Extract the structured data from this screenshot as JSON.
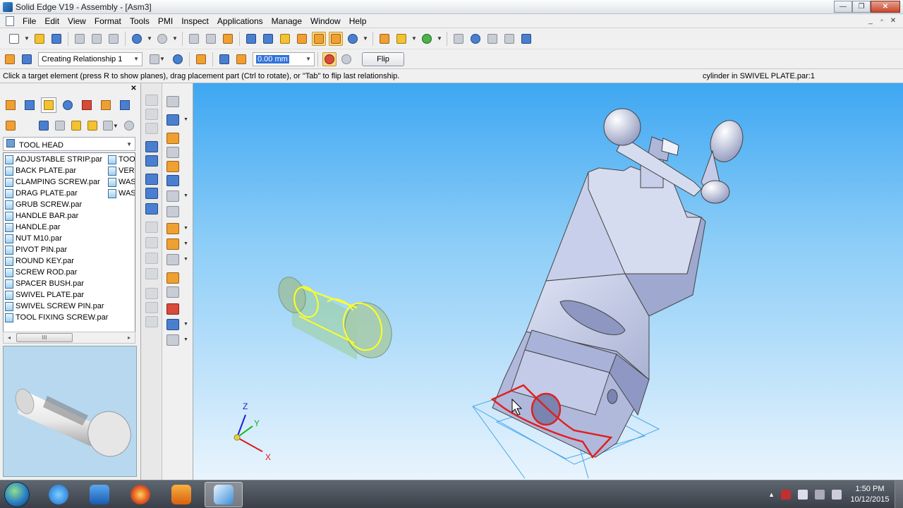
{
  "window": {
    "title": "Solid Edge V19 - Assembly - [Asm3]",
    "buttons": [
      "—",
      "❐",
      "✕"
    ]
  },
  "menubar": {
    "items": [
      "File",
      "Edit",
      "View",
      "Format",
      "Tools",
      "PMI",
      "Inspect",
      "Applications",
      "Manage",
      "Window",
      "Help"
    ],
    "mdi_buttons": [
      "_",
      "▫",
      "✕"
    ]
  },
  "toolbar2": {
    "relationship_value": "Creating Relationship 1",
    "offset_value": "0.00 mm",
    "flip_label": "Flip"
  },
  "promptbar": {
    "prompt": "Click a target element (press R to show planes), drag placement part (Ctrl to rotate), or \"Tab\" to flip last relationship.",
    "status": "cylinder in SWIVEL PLATE.par:1"
  },
  "library": {
    "close_glyph": "✕",
    "folder": "TOOL HEAD",
    "files_col1": [
      "ADJUSTABLE STRIP.par",
      "BACK PLATE.par",
      "CLAMPING SCREW.par",
      "DRAG PLATE.par",
      "GRUB SCREW.par",
      "HANDLE BAR.par",
      "HANDLE.par",
      "NUT M10.par",
      "PIVOT PIN.par",
      "ROUND KEY.par",
      "SCREW ROD.par",
      "SPACER BUSH.par",
      "SWIVEL PLATE.par",
      "SWIVEL SCREW PIN.par",
      "TOOL FIXING SCREW.par"
    ],
    "files_col2": [
      "TOO",
      "VER",
      "WAS",
      "WAS"
    ],
    "scroll_left": "◂",
    "scroll_right": "▸",
    "scroll_thumb": "III"
  },
  "triad": {
    "x_label": "X",
    "y_label": "Y",
    "z_label": "Z"
  },
  "taskbar": {
    "time": "1:50 PM",
    "date": "10/12/2015"
  },
  "colors": {
    "viewport_top": "#3ea7f2",
    "viewport_bottom": "#e9f4fd",
    "placement_part_outline": "#ffff22",
    "target_highlight": "#e02020",
    "part_fill": "#c7cde8"
  }
}
